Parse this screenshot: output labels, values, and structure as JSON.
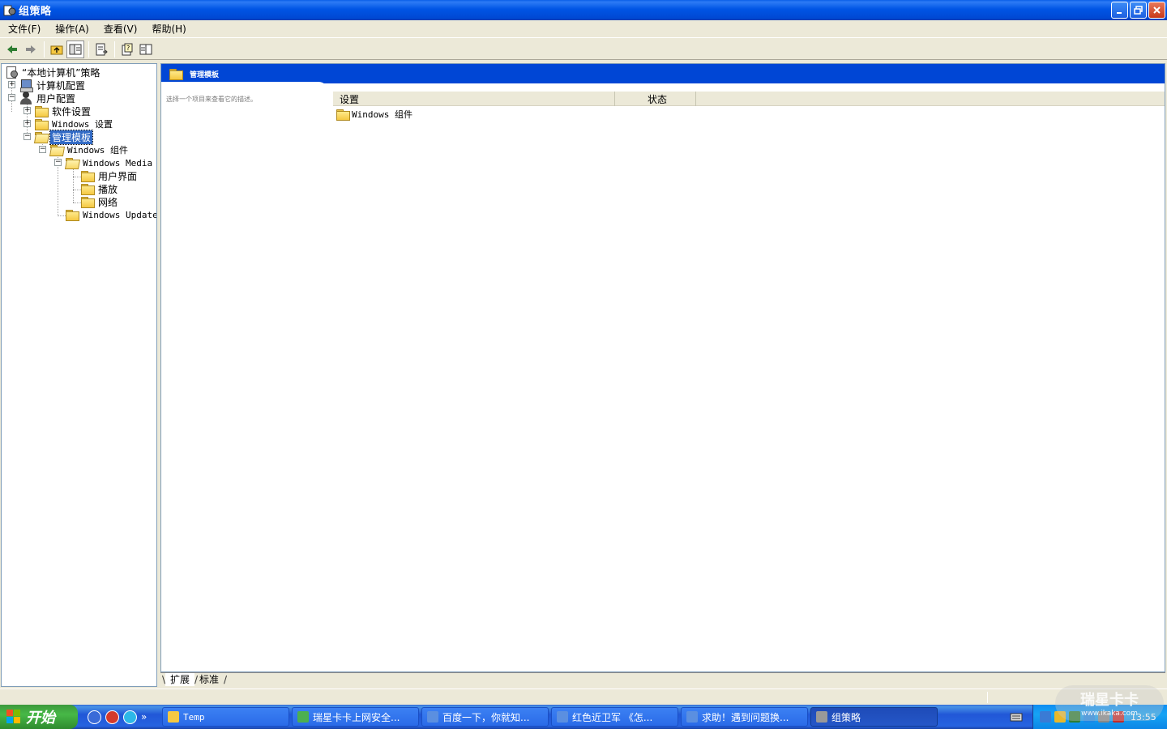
{
  "window": {
    "title": "组策略"
  },
  "menu": [
    {
      "label": "文件(F)"
    },
    {
      "label": "操作(A)"
    },
    {
      "label": "查看(V)"
    },
    {
      "label": "帮助(H)"
    }
  ],
  "tree": {
    "root": "“本地计算机”策略",
    "computer_config": "计算机配置",
    "user_config": "用户配置",
    "software_settings": "软件设置",
    "windows_settings": "Windows 设置",
    "admin_templates": "管理模板",
    "windows_components": "Windows 组件",
    "windows_media": "Windows Media P",
    "user_interface": "用户界面",
    "playback": "播放",
    "network": "网络",
    "windows_update": "Windows Update"
  },
  "right": {
    "banner_title": "管理模板",
    "description": "选择一个项目来查看它的描述。",
    "columns": [
      "设置",
      "状态"
    ],
    "rows": [
      {
        "name": "Windows 组件"
      }
    ]
  },
  "view_tabs": [
    "扩展",
    "标准"
  ],
  "taskbar": {
    "start": "开始",
    "more": "»",
    "tasks": [
      {
        "label": "Temp",
        "color": "#F5C842"
      },
      {
        "label": "瑞星卡卡上网安全...",
        "color": "#4CAF50"
      },
      {
        "label": "百度一下，你就知...",
        "color": "#5B8FE0"
      },
      {
        "label": "红色近卫军 《怎...",
        "color": "#5B8FE0"
      },
      {
        "label": "求助！遇到问题换...",
        "color": "#5B8FE0"
      },
      {
        "label": "组策略",
        "color": "#999999"
      }
    ],
    "clock": "13:55"
  },
  "watermark": {
    "brand": "瑞星卡卡",
    "url": "www.ikaka.com"
  }
}
